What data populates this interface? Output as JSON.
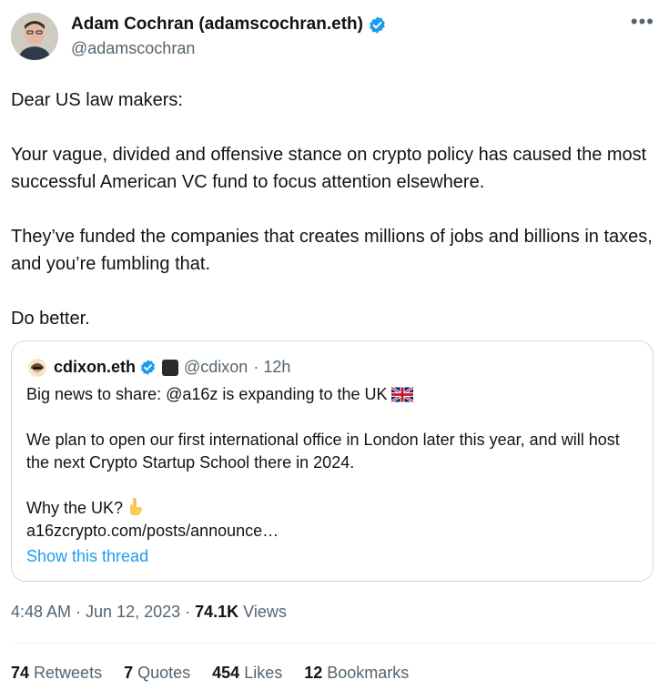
{
  "author": {
    "name": "Adam Cochran (adamscochran.eth)",
    "handle": "@adamscochran",
    "avatar_icon": "profile-photo"
  },
  "more_icon": "more-options-icon",
  "tweet": {
    "paragraphs": [
      "Dear US law makers:",
      "Your vague, divided and offensive stance on crypto policy has caused the most successful American VC fund to focus attention elsewhere.",
      "They’ve funded the companies that creates millions of jobs and billions in taxes, and you’re fumbling that.",
      "Do better."
    ]
  },
  "quote": {
    "name": "cdixon.eth",
    "handle": "@cdixon",
    "time": "· 12h",
    "badge_text": "a16z crypto",
    "line1": "Big news to share: @a16z is expanding to the UK",
    "line2": "We plan to open our first international office in London later this year, and will host the next Crypto Startup School there in 2024.",
    "line3": "Why the UK?",
    "link": "a16zcrypto.com/posts/announce…",
    "show_thread": "Show this thread"
  },
  "meta": {
    "time": "4:48 AM · Jun 12, 2023 · ",
    "views_count": "74.1K",
    "views_label": " Views"
  },
  "stats": [
    {
      "count": "74",
      "label": " Retweets"
    },
    {
      "count": "7",
      "label": " Quotes"
    },
    {
      "count": "454",
      "label": " Likes"
    },
    {
      "count": "12",
      "label": " Bookmarks"
    }
  ],
  "colors": {
    "link": "#1d9bf0",
    "secondary_text": "#536471",
    "border": "#cfd9de",
    "verified": "#1d9bf0"
  }
}
